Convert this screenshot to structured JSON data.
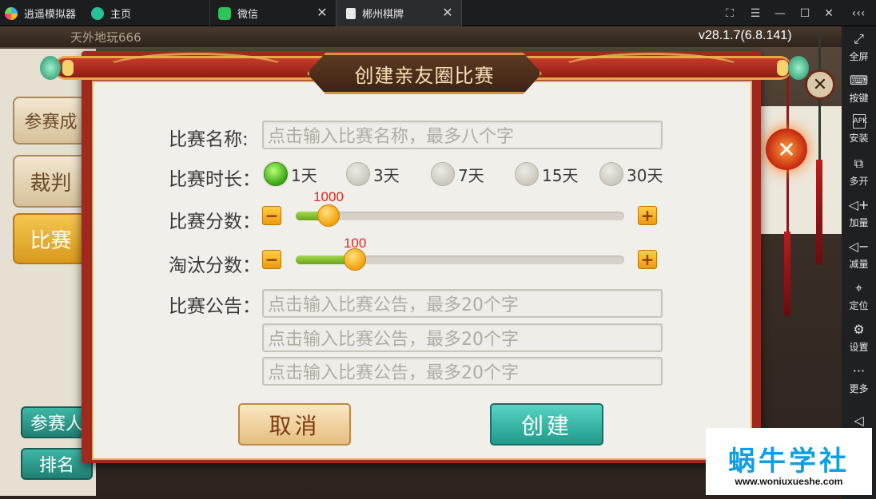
{
  "emulator": {
    "app_name": "逍遥模拟器",
    "tabs": [
      {
        "label": "主页"
      },
      {
        "label": "微信"
      },
      {
        "label": "郴州棋牌"
      }
    ],
    "version": "v28.1.7(6.8.141)",
    "sidebar": [
      {
        "label": "全屏",
        "icon": "fullscreen-icon"
      },
      {
        "label": "按键",
        "icon": "keyboard-icon"
      },
      {
        "label": "安装",
        "icon": "apk-icon"
      },
      {
        "label": "多开",
        "icon": "multi-instance-icon"
      },
      {
        "label": "加量",
        "icon": "volume-up-icon"
      },
      {
        "label": "减量",
        "icon": "volume-down-icon"
      },
      {
        "label": "定位",
        "icon": "location-icon"
      },
      {
        "label": "设置",
        "icon": "gear-icon"
      },
      {
        "label": "更多",
        "icon": "more-icon"
      }
    ]
  },
  "background": {
    "player_name": "天外地玩666",
    "side_buttons": [
      "参赛成",
      "裁判",
      "比赛"
    ],
    "bottom_buttons": [
      "参赛人",
      "排名"
    ]
  },
  "dialog": {
    "title": "创建亲友圈比赛",
    "name_label": "比赛名称:",
    "name_placeholder": "点击输入比赛名称，最多八个字",
    "duration_label": "比赛时长：",
    "duration_options": [
      "1天",
      "3天",
      "7天",
      "15天",
      "30天"
    ],
    "duration_selected": "1天",
    "score_label": "比赛分数：",
    "score_value": "1000",
    "score_fraction": 0.1,
    "elim_label": "淘汰分数：",
    "elim_value": "100",
    "elim_fraction": 0.18,
    "notice_label": "比赛公告：",
    "notice_placeholders": [
      "点击输入比赛公告，最多20个字",
      "点击输入比赛公告，最多20个字",
      "点击输入比赛公告，最多20个字"
    ],
    "cancel_label": "取消",
    "create_label": "创建"
  },
  "watermark": {
    "name": "蜗牛学社",
    "url": "www.woniuxueshe.com"
  },
  "colors": {
    "accent_red": "#a0281d",
    "create_teal": "#219a8b",
    "slider_value": "#e8241d"
  }
}
